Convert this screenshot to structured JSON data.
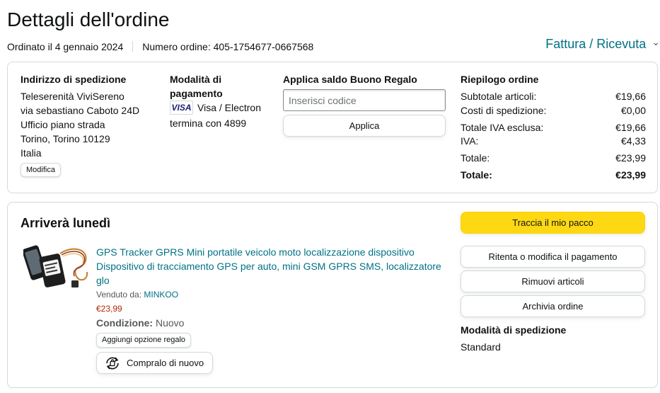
{
  "header": {
    "title": "Dettagli dell'ordine",
    "ordered_on": "Ordinato il 4 gennaio 2024",
    "order_number": "Numero ordine: 405-1754677-0667568",
    "invoice_link": "Fattura / Ricevuta",
    "invoice_chevron": "⌄"
  },
  "shipping_address": {
    "title": "Indirizzo di spedizione",
    "lines": [
      "Teleserenità ViviSereno",
      "via sebastiano Caboto 24D",
      "Ufficio piano strada",
      "Torino, Torino 10129",
      "Italia"
    ],
    "edit_label": "Modifica"
  },
  "payment": {
    "title": "Modalità di pagamento",
    "card_logo": "VISA",
    "card_type": "Visa / Electron",
    "card_ending": "termina con 4899"
  },
  "gift_card": {
    "title": "Applica saldo Buono Regalo",
    "placeholder": "Inserisci codice",
    "apply_label": "Applica"
  },
  "summary": {
    "title": "Riepilogo ordine",
    "rows": [
      {
        "label": "Subtotale articoli:",
        "value": "€19,66"
      },
      {
        "label": "Costi di spedizione:",
        "value": "€0,00"
      },
      {
        "label": "Totale IVA esclusa:",
        "value": "€19,66"
      },
      {
        "label": "IVA:",
        "value": "€4,33"
      },
      {
        "label": "Totale:",
        "value": "€23,99"
      },
      {
        "label": "Totale:",
        "value": "€23,99"
      }
    ]
  },
  "shipment": {
    "arrival": "Arriverà lunedì",
    "product": {
      "title": "GPS Tracker GPRS Mini portatile veicolo moto localizzazione dispositivo Dispositivo di tracciamento GPS per auto, mini GSM GPRS SMS, localizzatore glo",
      "sold_by_label": "Venduto da:",
      "seller": "MINKOO",
      "price": "€23,99",
      "condition_label": "Condizione:",
      "condition": "Nuovo",
      "gift_label": "Aggiungi opzione regalo",
      "rebuy_label": "Compralo di nuovo"
    },
    "actions": {
      "track": "Traccia il mio pacco",
      "retry_payment": "Ritenta o modifica il pagamento",
      "remove_items": "Rimuovi articoli",
      "archive": "Archivia ordine"
    },
    "shipping_mode_title": "Modalità di spedizione",
    "shipping_mode": "Standard"
  },
  "colors": {
    "link": "#007185",
    "price": "#b12704",
    "primary_button": "#ffd814",
    "border": "#d5d9d9"
  }
}
